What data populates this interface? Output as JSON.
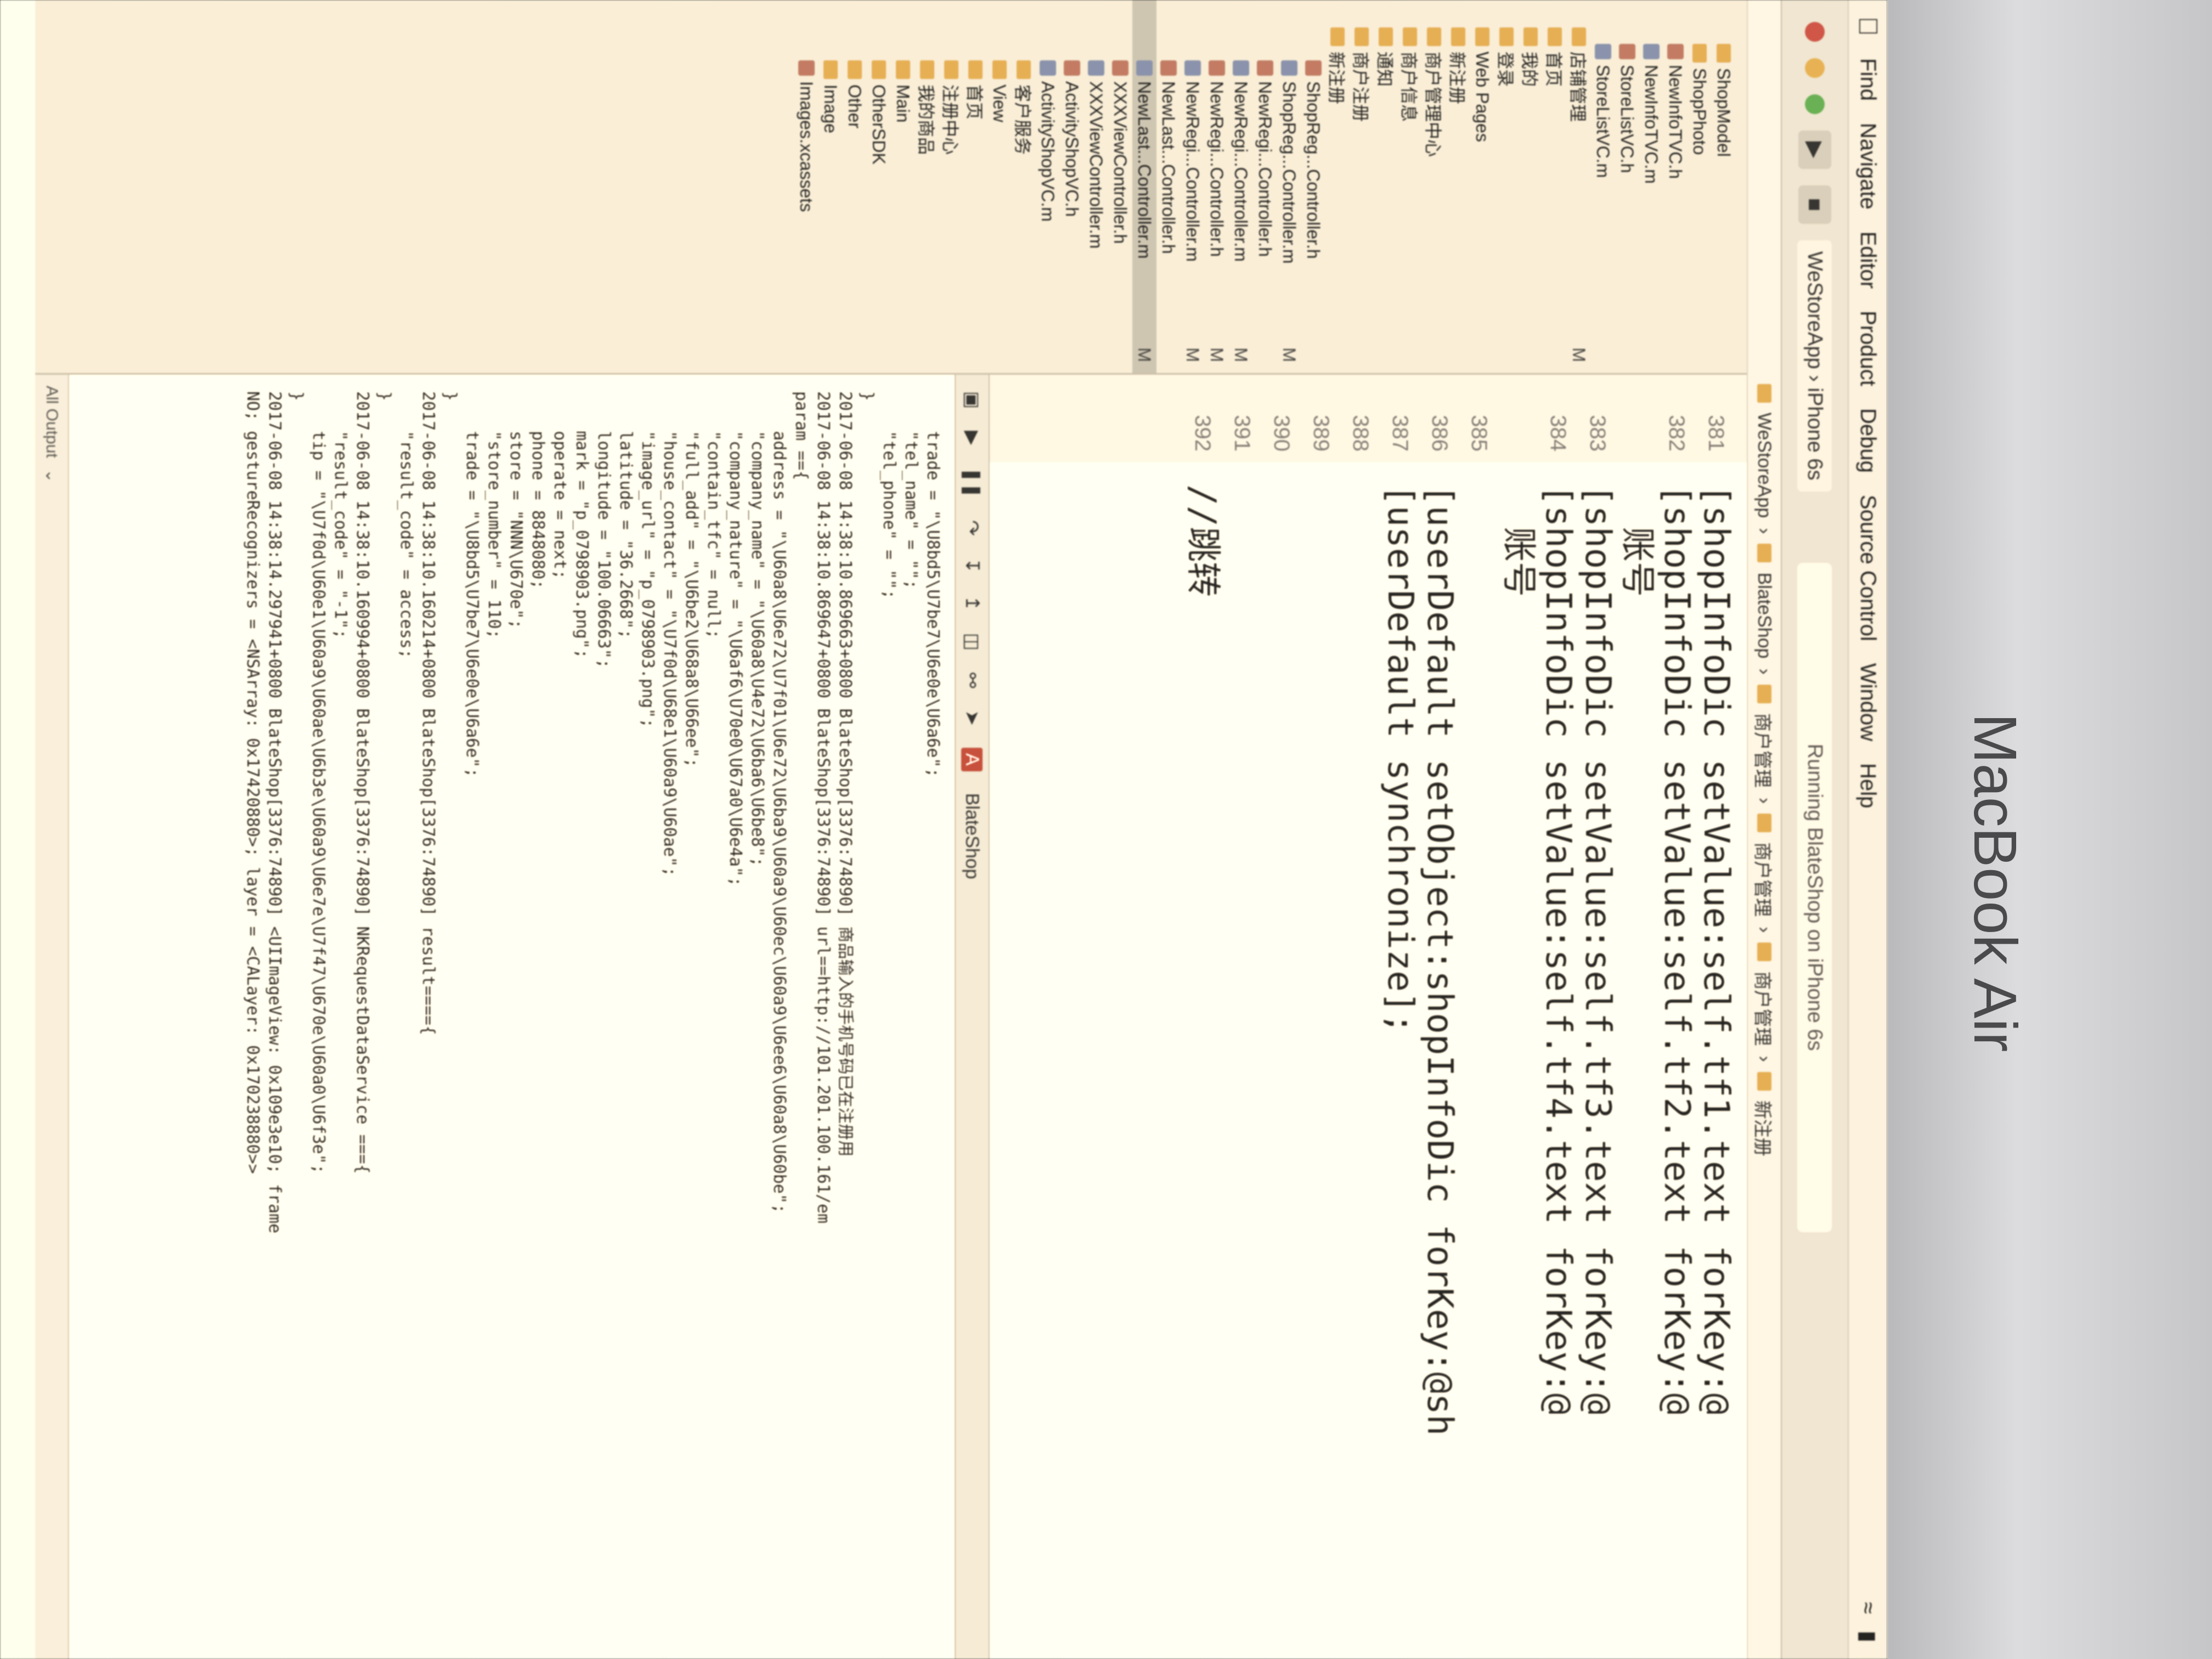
{
  "menubar": {
    "items": [
      "Find",
      "Navigate",
      "Editor",
      "Product",
      "Debug",
      "Source Control",
      "Window",
      "Help"
    ]
  },
  "toolbar": {
    "scheme": "WeStoreApp",
    "device": "iPhone 6s",
    "status": "Running BlateShop on iPhone 6s"
  },
  "jumpbar": {
    "items": [
      "WeStoreApp",
      "BlateShop",
      "商户管理",
      "商户管理",
      "商户管理",
      "新注册"
    ]
  },
  "navigator": {
    "items": [
      {
        "label": "ShopModel",
        "badge": ""
      },
      {
        "label": "ShopPhoto",
        "badge": ""
      },
      {
        "label": "NewInfoTVC.h",
        "badge": ""
      },
      {
        "label": "NewInfoTVC.m",
        "badge": ""
      },
      {
        "label": "StoreListVC.h",
        "badge": ""
      },
      {
        "label": "StoreListVC.m",
        "badge": ""
      },
      {
        "label": "店铺管理",
        "badge": "M"
      },
      {
        "label": "首页",
        "badge": ""
      },
      {
        "label": "我的",
        "badge": ""
      },
      {
        "label": "登录",
        "badge": ""
      },
      {
        "label": "Web Pages",
        "badge": ""
      },
      {
        "label": "新注册",
        "badge": ""
      },
      {
        "label": "商户管理中心",
        "badge": ""
      },
      {
        "label": "商户信息",
        "badge": ""
      },
      {
        "label": "通知",
        "badge": ""
      },
      {
        "label": "商户注册",
        "badge": ""
      },
      {
        "label": "新注册",
        "badge": ""
      },
      {
        "label": "ShopReg...Controller.h",
        "badge": ""
      },
      {
        "label": "ShopReg...Controller.m",
        "badge": "M"
      },
      {
        "label": "NewRegi...Controller.h",
        "badge": ""
      },
      {
        "label": "NewRegi...Controller.m",
        "badge": "M"
      },
      {
        "label": "NewRegi...Controller.h",
        "badge": "M"
      },
      {
        "label": "NewRegi...Controller.m",
        "badge": "M"
      },
      {
        "label": "NewLast...Controller.h",
        "badge": ""
      },
      {
        "label": "NewLast...Controller.m",
        "badge": "M"
      },
      {
        "label": "XXXViewController.h",
        "badge": ""
      },
      {
        "label": "XXXViewController.m",
        "badge": ""
      },
      {
        "label": "ActivityShopVC.h",
        "badge": ""
      },
      {
        "label": "ActivityShopVC.m",
        "badge": ""
      },
      {
        "label": "客户服务",
        "badge": ""
      },
      {
        "label": "View",
        "badge": ""
      },
      {
        "label": "首页",
        "badge": ""
      },
      {
        "label": "注册中心",
        "badge": ""
      },
      {
        "label": "我的商品",
        "badge": ""
      },
      {
        "label": "Main",
        "badge": ""
      },
      {
        "label": "OtherSDK",
        "badge": ""
      },
      {
        "label": "Other",
        "badge": ""
      },
      {
        "label": "Image",
        "badge": ""
      },
      {
        "label": "Images.xcassets",
        "badge": ""
      }
    ]
  },
  "editor": {
    "line_numbers": [
      "381",
      "382",
      "",
      "383",
      "384",
      "",
      "385",
      "386",
      "387",
      "388",
      "389",
      "390",
      "391",
      "392"
    ],
    "lines": [
      "[shopInfoDic setValue:self.tf1.text forKey:@",
      "[shopInfoDic setValue:self.tf2.text forKey:@",
      "  账号",
      "[shopInfoDic setValue:self.tf3.text forKey:@",
      "[shopInfoDic setValue:self.tf4.text forKey:@",
      "  账号",
      "",
      "[userDefault setObject:shopInfoDic forKey:@sh",
      "[userDefault synchronize];",
      "",
      "",
      "",
      "",
      "//跳转"
    ]
  },
  "debugbar": {
    "target": "BlateShop"
  },
  "console": {
    "lines": [
      "    trade = \"\\U8bd5\\U7be7\\U6e0e\\U6a6e\";",
      "    \"tel_name\" = \"\";",
      "    \"tel_phone\" = \"\";",
      "}",
      "2017-06-08 14:38:10.869663+0800 BlateShop[3376:74890] 商品输入的手机号码已在注册用",
      "2017-06-08 14:38:10.869647+0800 BlateShop[3376:74890] url==http://101.201.100.161/em",
      "param =={",
      "    address = \"\\U60a8\\U6e72\\U7f01\\U6e72\\U6ba9\\U60a9\\U60ec\\U60a9\\U6ee6\\U60a8\\U60be\";",
      "    \"company_name\" = \"\\U60a8\\U4e72\\U6ba6\\U6be8\";",
      "    \"company_nature\" = \"\\U6af6\\U70e0\\U67a0\\U6e4a\";",
      "    \"contain_tfc\" = null;",
      "    \"full_add\" = \"\\U6be2\\U68a8\\U66ee\";",
      "    \"house_contact\" = \"\\U7f0d\\U68e1\\U60a9\\U60ae\";",
      "    \"image_url\" = \"p_0798903.png\";",
      "    latitude = \"36.2668\";",
      "    longitude = \"100.06663\";",
      "    mark = \"p_0798903.png\";",
      "    operate = next;",
      "    phone = 8848080;",
      "    store = \"NNN\\U670e\";",
      "    \"store_number\" = 110;",
      "    trade = \"\\U8bd5\\U7be7\\U6e0e\\U6a6e\";",
      "}",
      "2017-06-08 14:38:10.160214+0800 BlateShop[3376:74890] result===={",
      "    \"result_code\" = access;",
      "}",
      "2017-06-08 14:38:10.160994+0800 BlateShop[3376:74890] NKRequestDataService ==={",
      "    \"result_code\" = \"-1\";",
      "    tip = \"\\U7f0d\\U60e1\\U60a9\\U60ae\\U6b3e\\U60a9\\U6e7e\\U7f47\\U670e\\U60a0\\U6f3e\";",
      "}",
      "2017-06-08 14:38:14.297941+0800 BlateShop[3376:74890] <UIImageView: 0x109e3e10; frame",
      "NO; gestureRecognizers = <NSArray: 0x17420880>; layer = <CALayer: 0x170238880>>"
    ]
  },
  "footer": {
    "output_label": "All Output"
  },
  "device_brand": "MacBook Air"
}
